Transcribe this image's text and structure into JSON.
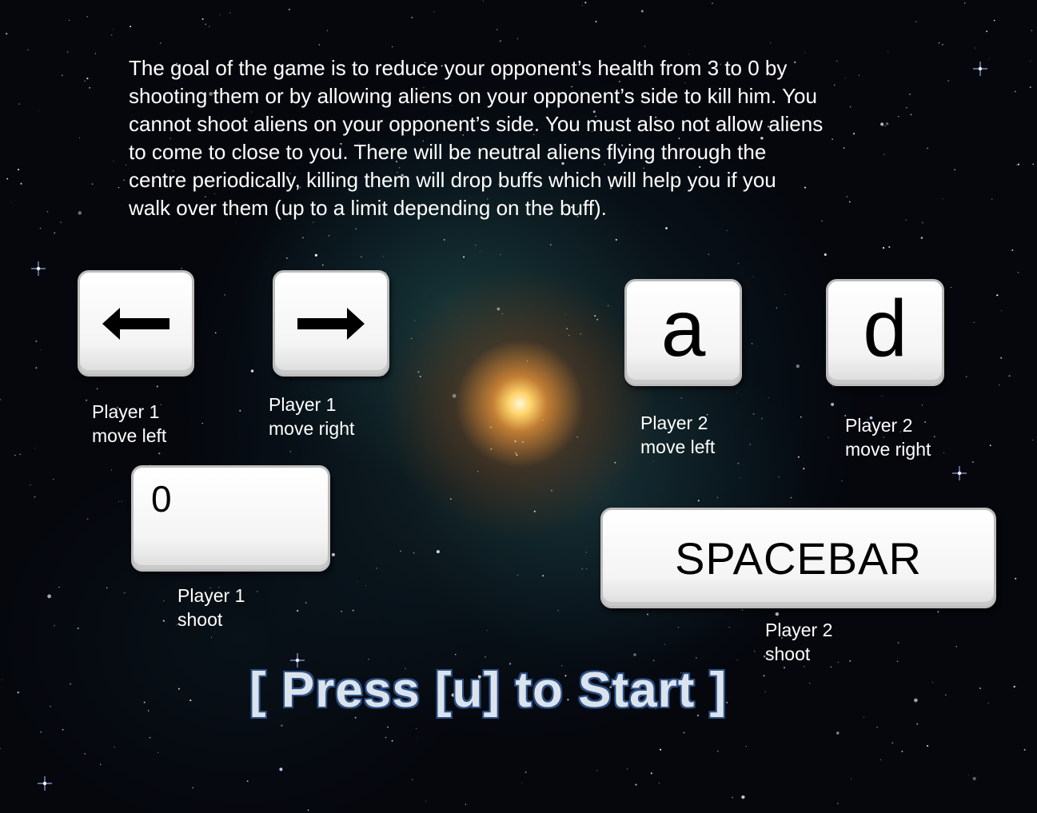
{
  "instructions": {
    "lines": [
      "The goal of the game is to reduce your opponent’s health from 3 to 0 by",
      "shooting them or by allowing aliens on your opponent’s side to kill him. You",
      "cannot shoot aliens on your opponent’s side. You must also not allow aliens",
      "to come to close to you. There will be neutral aliens flying through the",
      "centre periodically, killing them will drop buffs which will help you if you",
      "walk over them (up to a limit depending on the buff)."
    ]
  },
  "controls": {
    "p1_left": {
      "key_icon": "arrow-left-icon",
      "label_lines": [
        "Player 1",
        "move left"
      ]
    },
    "p1_right": {
      "key_icon": "arrow-right-icon",
      "label_lines": [
        "Player 1",
        "move right"
      ]
    },
    "p2_left": {
      "key": "a",
      "label_lines": [
        "Player 2",
        "move left"
      ]
    },
    "p2_right": {
      "key": "d",
      "label_lines": [
        "Player 2",
        "move right"
      ]
    },
    "p1_shoot": {
      "key": "0",
      "label_lines": [
        "Player 1",
        "shoot"
      ]
    },
    "p2_shoot": {
      "key": "SPACEBAR",
      "label_lines": [
        "Player 2",
        "shoot"
      ]
    }
  },
  "start_prompt": "[ Press [u] to Start ]",
  "colors": {
    "background": "#05070d",
    "text": "#ffffff",
    "start_fill": "#dbe4ec",
    "start_outline": "#2d4f86",
    "key_face": "#ffffff",
    "key_border": "#bdbdbd"
  }
}
